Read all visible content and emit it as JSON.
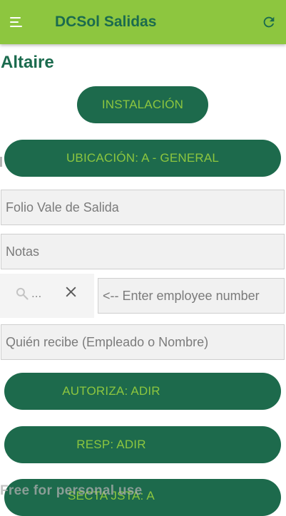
{
  "appbar": {
    "title": "DCSol Salidas",
    "menu_icon": "hamburger-menu-icon",
    "refresh_icon": "refresh-icon",
    "color": "#8dc63f",
    "title_color": "#1b6b4e"
  },
  "site": {
    "name": "Altaire"
  },
  "buttons": {
    "instalacion": "INSTALACIÓN",
    "ubicacion": "UBICACIÓN: A - GENERAL",
    "autoriza": "AUTORIZA: ADIR",
    "resp": "RESP: ADIR",
    "partial": "SECTA JSTA: A"
  },
  "fields": {
    "folio_placeholder": "Folio Vale de Salida",
    "notas_placeholder": "Notas",
    "employee_placeholder": "<-- Enter employee number",
    "recibe_placeholder": "Quién recibe (Empleado o Nombre)"
  },
  "search": {
    "icon": "search-icon",
    "value": "...",
    "clear_icon": "close-icon"
  },
  "watermark": "Free for personal use",
  "colors": {
    "button_bg": "#1d6a4c",
    "button_text": "#8dc63f"
  }
}
